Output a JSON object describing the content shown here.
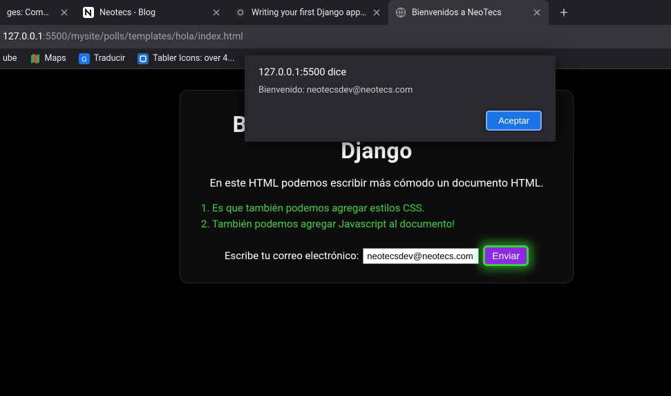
{
  "tabs": [
    {
      "title": "ges: Compete",
      "active": false
    },
    {
      "title": "Neotecs - Blog",
      "active": false
    },
    {
      "title": "Writing your first Django app, p",
      "active": false
    },
    {
      "title": "Bienvenidos a NeoTecs",
      "active": true
    }
  ],
  "address": {
    "host": "127.0.0.1",
    "path": ":5500/mysite/polls/templates/hola/index.html"
  },
  "bookmarks": [
    {
      "label": "ube"
    },
    {
      "label": "Maps"
    },
    {
      "label": "Traducir"
    },
    {
      "label": "Tabler Icons: over 4..."
    }
  ],
  "page": {
    "heading": "Bienvenidos a este curso de Django",
    "lead": "En este HTML podemos escribir más cómodo un documento HTML.",
    "list": [
      "Es que también podemos agregar estilos CSS.",
      "También podemos agregar Javascript al documento!"
    ],
    "form": {
      "label": "Escribe tu correo electrónico:",
      "value": "neotecsdev@neotecs.com",
      "submit": "Enviar"
    }
  },
  "alert": {
    "title": "127.0.0.1:5500 dice",
    "body": "Bienvenido: neotecsdev@neotecs.com",
    "ok": "Aceptar"
  }
}
